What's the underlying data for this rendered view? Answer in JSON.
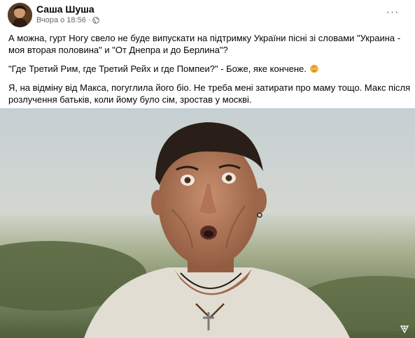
{
  "post": {
    "author": "Саша Шуша",
    "timestamp": "Вчора о 18:56",
    "separator": "·",
    "privacy_icon": "globe-icon",
    "more_icon": "more-options-icon",
    "more_label": "···"
  },
  "content": {
    "paragraph1": "А можна, гурт Ногу свело не буде випускати на підтримку України пісні зі словами \"Украина - моя вторая половина\" и \"От Днепра и до Берлина\"?",
    "paragraph2": "\"Где Третий Рим, где Третий Рейх и где Помпеи?\" - Боже, яке кончене.",
    "paragraph2_emoji": "facepalm-emoji",
    "paragraph3": "Я, на відміну від Макса, погуглила його біо. Не треба мені затирати про маму тощо. Макс після розлучення батьків, коли йому було сім, зростав у москві."
  },
  "media": {
    "type": "photo",
    "watermark_icon": "video-brand-icon"
  }
}
